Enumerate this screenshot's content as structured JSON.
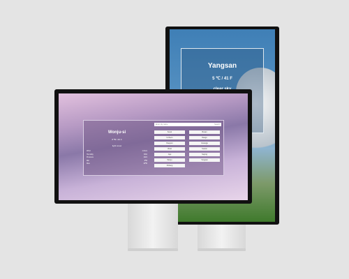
{
  "back_monitor": {
    "city": "Yangsan",
    "temperature": "5 ℃ / 41 F",
    "condition": "clear sky"
  },
  "front_monitor": {
    "city": "Wonju-si",
    "temperature": "8 ℃ / 46 F",
    "condition": "light snow",
    "details": [
      [
        "Wind",
        "1.6m/s"
      ],
      [
        "Humidity",
        "84%"
      ],
      [
        "Pressure",
        "1021"
      ],
      [
        "Min",
        "6℃"
      ],
      [
        "Max",
        "10℃"
      ]
    ],
    "search": {
      "placeholder": "Enter city name",
      "button": "Search"
    },
    "cities": [
      "Seoul",
      "Busan",
      "Incheon",
      "Daegu",
      "Daejeon",
      "Gwangju",
      "Ulsan",
      "Suwon",
      "Jeju",
      "Sejong",
      "Wonju",
      "Yangsan",
      "Pohang"
    ]
  }
}
